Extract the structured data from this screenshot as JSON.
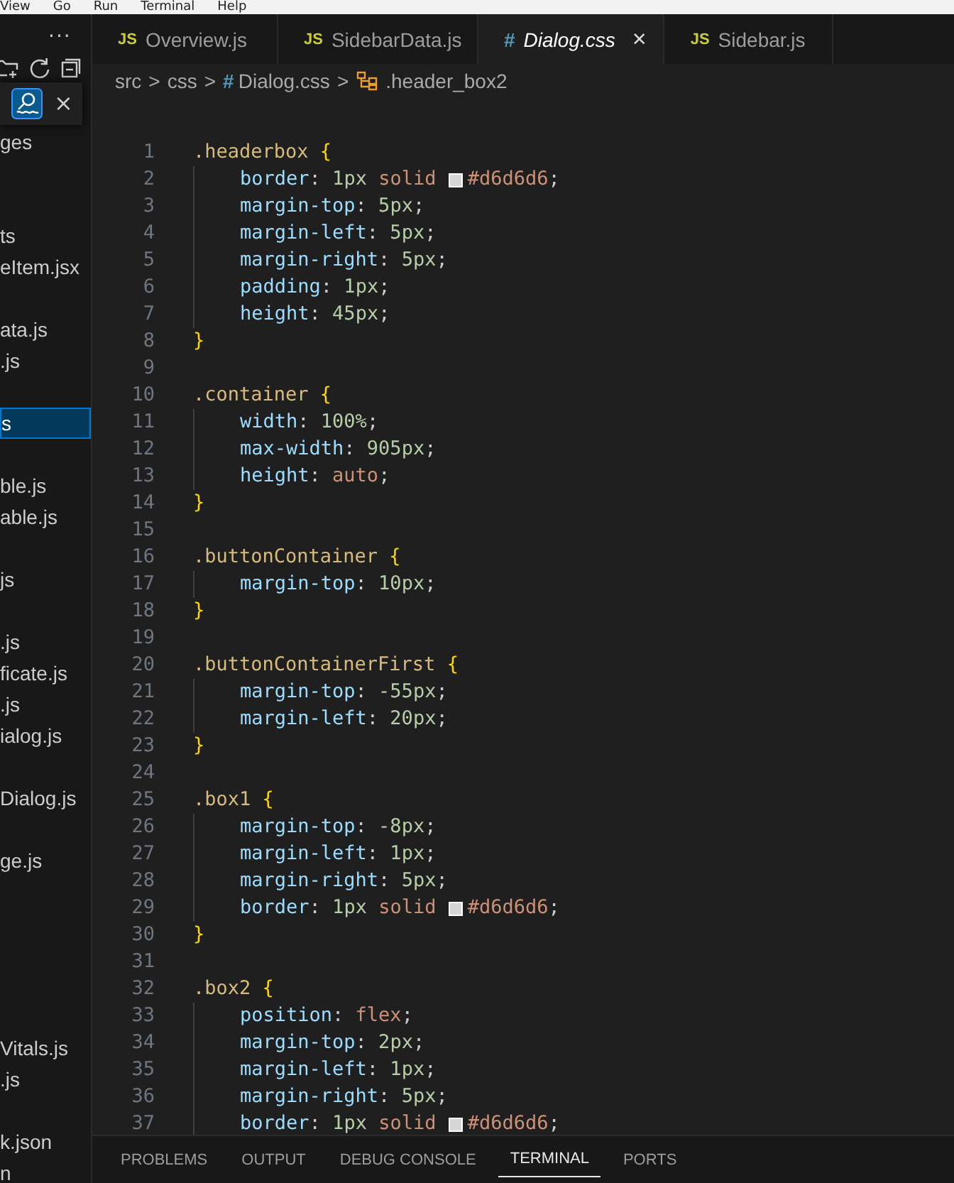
{
  "menu_bar": [
    "View",
    "Go",
    "Run",
    "Terminal",
    "Help"
  ],
  "explorer": {
    "more": "···",
    "find_close": "×",
    "items": [
      {
        "kind": "file",
        "label": "ges",
        "selected": false
      },
      {
        "kind": "blank"
      },
      {
        "kind": "blank"
      },
      {
        "kind": "file",
        "label": "ts",
        "selected": false
      },
      {
        "kind": "file",
        "label": "eItem.jsx",
        "selected": false
      },
      {
        "kind": "blank"
      },
      {
        "kind": "file",
        "label": "ata.js",
        "selected": false
      },
      {
        "kind": "file",
        "label": ".js",
        "selected": false
      },
      {
        "kind": "blank"
      },
      {
        "kind": "file",
        "label": "s",
        "selected": true
      },
      {
        "kind": "blank"
      },
      {
        "kind": "file",
        "label": "ble.js",
        "selected": false
      },
      {
        "kind": "file",
        "label": "able.js",
        "selected": false
      },
      {
        "kind": "blank"
      },
      {
        "kind": "file",
        "label": "js",
        "selected": false
      },
      {
        "kind": "blank"
      },
      {
        "kind": "file",
        "label": ".js",
        "selected": false
      },
      {
        "kind": "file",
        "label": "ficate.js",
        "selected": false
      },
      {
        "kind": "file",
        "label": ".js",
        "selected": false
      },
      {
        "kind": "file",
        "label": "ialog.js",
        "selected": false
      },
      {
        "kind": "blank"
      },
      {
        "kind": "file",
        "label": "Dialog.js",
        "selected": false
      },
      {
        "kind": "blank"
      },
      {
        "kind": "file",
        "label": "ge.js",
        "selected": false
      },
      {
        "kind": "blank"
      },
      {
        "kind": "blank"
      },
      {
        "kind": "blank"
      },
      {
        "kind": "blank"
      },
      {
        "kind": "blank"
      },
      {
        "kind": "file",
        "label": "Vitals.js",
        "selected": false
      },
      {
        "kind": "file",
        "label": ".js",
        "selected": false
      },
      {
        "kind": "blank"
      },
      {
        "kind": "file",
        "label": "k.json",
        "selected": false
      },
      {
        "kind": "file",
        "label": "n",
        "selected": false
      }
    ]
  },
  "tabs": [
    {
      "kind": "js",
      "badge": "JS",
      "label": "Overview.js",
      "selected": false
    },
    {
      "kind": "js",
      "badge": "JS",
      "label": "SidebarData.js",
      "selected": false
    },
    {
      "kind": "css",
      "badge": "#",
      "label": "Dialog.css",
      "selected": true,
      "close": "×"
    },
    {
      "kind": "js",
      "badge": "JS",
      "label": "Sidebar.js",
      "selected": false
    }
  ],
  "breadcrumb": [
    {
      "kind": "text",
      "label": "src"
    },
    {
      "kind": "sep",
      "label": ">"
    },
    {
      "kind": "text",
      "label": "css"
    },
    {
      "kind": "sep",
      "label": ">"
    },
    {
      "kind": "css",
      "badge": "#",
      "label": "Dialog.css"
    },
    {
      "kind": "sep",
      "label": ">"
    },
    {
      "kind": "symbol",
      "label": ".header_box2"
    }
  ],
  "code": [
    {
      "n": "1",
      "indent": false,
      "tokens": [
        {
          "kind": "sel",
          "text": ".headerbox "
        },
        {
          "kind": "brace",
          "text": "{"
        }
      ]
    },
    {
      "n": "2",
      "indent": true,
      "tokens": [
        {
          "kind": "prop",
          "text": "border"
        },
        {
          "kind": "punct",
          "text": ": "
        },
        {
          "kind": "num",
          "text": "1"
        },
        {
          "kind": "num",
          "text": "px"
        },
        {
          "kind": "val",
          "text": " solid "
        },
        {
          "kind": "swatch",
          "color": "#d6d6d6"
        },
        {
          "kind": "val",
          "text": "#d6d6d6"
        },
        {
          "kind": "punct",
          "text": ";"
        }
      ]
    },
    {
      "n": "3",
      "indent": true,
      "tokens": [
        {
          "kind": "prop",
          "text": "margin-top"
        },
        {
          "kind": "punct",
          "text": ": "
        },
        {
          "kind": "num",
          "text": "5"
        },
        {
          "kind": "num",
          "text": "px"
        },
        {
          "kind": "punct",
          "text": ";"
        }
      ]
    },
    {
      "n": "4",
      "indent": true,
      "tokens": [
        {
          "kind": "prop",
          "text": "margin-left"
        },
        {
          "kind": "punct",
          "text": ": "
        },
        {
          "kind": "num",
          "text": "5"
        },
        {
          "kind": "num",
          "text": "px"
        },
        {
          "kind": "punct",
          "text": ";"
        }
      ]
    },
    {
      "n": "5",
      "indent": true,
      "tokens": [
        {
          "kind": "prop",
          "text": "margin-right"
        },
        {
          "kind": "punct",
          "text": ": "
        },
        {
          "kind": "num",
          "text": "5"
        },
        {
          "kind": "num",
          "text": "px"
        },
        {
          "kind": "punct",
          "text": ";"
        }
      ]
    },
    {
      "n": "6",
      "indent": true,
      "tokens": [
        {
          "kind": "prop",
          "text": "padding"
        },
        {
          "kind": "punct",
          "text": ": "
        },
        {
          "kind": "num",
          "text": "1"
        },
        {
          "kind": "num",
          "text": "px"
        },
        {
          "kind": "punct",
          "text": ";"
        }
      ]
    },
    {
      "n": "7",
      "indent": true,
      "tokens": [
        {
          "kind": "prop",
          "text": "height"
        },
        {
          "kind": "punct",
          "text": ": "
        },
        {
          "kind": "num",
          "text": "45"
        },
        {
          "kind": "num",
          "text": "px"
        },
        {
          "kind": "punct",
          "text": ";"
        }
      ]
    },
    {
      "n": "8",
      "indent": false,
      "tokens": [
        {
          "kind": "brace",
          "text": "}"
        }
      ]
    },
    {
      "n": "9"
    },
    {
      "n": "10",
      "indent": false,
      "tokens": [
        {
          "kind": "sel",
          "text": ".container "
        },
        {
          "kind": "brace",
          "text": "{"
        }
      ]
    },
    {
      "n": "11",
      "indent": true,
      "tokens": [
        {
          "kind": "prop",
          "text": "width"
        },
        {
          "kind": "punct",
          "text": ": "
        },
        {
          "kind": "num",
          "text": "100"
        },
        {
          "kind": "num",
          "text": "%"
        },
        {
          "kind": "punct",
          "text": ";"
        }
      ]
    },
    {
      "n": "12",
      "indent": true,
      "tokens": [
        {
          "kind": "prop",
          "text": "max-width"
        },
        {
          "kind": "punct",
          "text": ": "
        },
        {
          "kind": "num",
          "text": "905"
        },
        {
          "kind": "num",
          "text": "px"
        },
        {
          "kind": "punct",
          "text": ";"
        }
      ]
    },
    {
      "n": "13",
      "indent": true,
      "tokens": [
        {
          "kind": "prop",
          "text": "height"
        },
        {
          "kind": "punct",
          "text": ": "
        },
        {
          "kind": "val",
          "text": "auto"
        },
        {
          "kind": "punct",
          "text": ";"
        }
      ]
    },
    {
      "n": "14",
      "indent": false,
      "tokens": [
        {
          "kind": "brace",
          "text": "}"
        }
      ]
    },
    {
      "n": "15"
    },
    {
      "n": "16",
      "indent": false,
      "tokens": [
        {
          "kind": "sel",
          "text": ".buttonContainer "
        },
        {
          "kind": "brace",
          "text": "{"
        }
      ]
    },
    {
      "n": "17",
      "indent": true,
      "tokens": [
        {
          "kind": "prop",
          "text": "margin-top"
        },
        {
          "kind": "punct",
          "text": ": "
        },
        {
          "kind": "num",
          "text": "10"
        },
        {
          "kind": "num",
          "text": "px"
        },
        {
          "kind": "punct",
          "text": ";"
        }
      ]
    },
    {
      "n": "18",
      "indent": false,
      "tokens": [
        {
          "kind": "brace",
          "text": "}"
        }
      ]
    },
    {
      "n": "19"
    },
    {
      "n": "20",
      "indent": false,
      "tokens": [
        {
          "kind": "sel",
          "text": ".buttonContainerFirst "
        },
        {
          "kind": "brace",
          "text": "{"
        }
      ]
    },
    {
      "n": "21",
      "indent": true,
      "tokens": [
        {
          "kind": "prop",
          "text": "margin-top"
        },
        {
          "kind": "punct",
          "text": ": "
        },
        {
          "kind": "num",
          "text": "-55"
        },
        {
          "kind": "num",
          "text": "px"
        },
        {
          "kind": "punct",
          "text": ";"
        }
      ]
    },
    {
      "n": "22",
      "indent": true,
      "tokens": [
        {
          "kind": "prop",
          "text": "margin-left"
        },
        {
          "kind": "punct",
          "text": ": "
        },
        {
          "kind": "num",
          "text": "20"
        },
        {
          "kind": "num",
          "text": "px"
        },
        {
          "kind": "punct",
          "text": ";"
        }
      ]
    },
    {
      "n": "23",
      "indent": false,
      "tokens": [
        {
          "kind": "brace",
          "text": "}"
        }
      ]
    },
    {
      "n": "24"
    },
    {
      "n": "25",
      "indent": false,
      "tokens": [
        {
          "kind": "sel",
          "text": ".box1 "
        },
        {
          "kind": "brace",
          "text": "{"
        }
      ]
    },
    {
      "n": "26",
      "indent": true,
      "tokens": [
        {
          "kind": "prop",
          "text": "margin-top"
        },
        {
          "kind": "punct",
          "text": ": "
        },
        {
          "kind": "num",
          "text": "-8"
        },
        {
          "kind": "num",
          "text": "px"
        },
        {
          "kind": "punct",
          "text": ";"
        }
      ]
    },
    {
      "n": "27",
      "indent": true,
      "tokens": [
        {
          "kind": "prop",
          "text": "margin-left"
        },
        {
          "kind": "punct",
          "text": ": "
        },
        {
          "kind": "num",
          "text": "1"
        },
        {
          "kind": "num",
          "text": "px"
        },
        {
          "kind": "punct",
          "text": ";"
        }
      ]
    },
    {
      "n": "28",
      "indent": true,
      "tokens": [
        {
          "kind": "prop",
          "text": "margin-right"
        },
        {
          "kind": "punct",
          "text": ": "
        },
        {
          "kind": "num",
          "text": "5"
        },
        {
          "kind": "num",
          "text": "px"
        },
        {
          "kind": "punct",
          "text": ";"
        }
      ]
    },
    {
      "n": "29",
      "indent": true,
      "tokens": [
        {
          "kind": "prop",
          "text": "border"
        },
        {
          "kind": "punct",
          "text": ": "
        },
        {
          "kind": "num",
          "text": "1"
        },
        {
          "kind": "num",
          "text": "px"
        },
        {
          "kind": "val",
          "text": " solid "
        },
        {
          "kind": "swatch",
          "color": "#d6d6d6"
        },
        {
          "kind": "val",
          "text": "#d6d6d6"
        },
        {
          "kind": "punct",
          "text": ";"
        }
      ]
    },
    {
      "n": "30",
      "indent": false,
      "tokens": [
        {
          "kind": "brace",
          "text": "}"
        }
      ]
    },
    {
      "n": "31"
    },
    {
      "n": "32",
      "indent": false,
      "tokens": [
        {
          "kind": "sel",
          "text": ".box2 "
        },
        {
          "kind": "brace",
          "text": "{"
        }
      ]
    },
    {
      "n": "33",
      "indent": true,
      "tokens": [
        {
          "kind": "prop",
          "text": "position"
        },
        {
          "kind": "punct",
          "text": ": "
        },
        {
          "kind": "val",
          "text": "flex"
        },
        {
          "kind": "punct",
          "text": ";"
        }
      ]
    },
    {
      "n": "34",
      "indent": true,
      "tokens": [
        {
          "kind": "prop",
          "text": "margin-top"
        },
        {
          "kind": "punct",
          "text": ": "
        },
        {
          "kind": "num",
          "text": "2"
        },
        {
          "kind": "num",
          "text": "px"
        },
        {
          "kind": "punct",
          "text": ";"
        }
      ]
    },
    {
      "n": "35",
      "indent": true,
      "tokens": [
        {
          "kind": "prop",
          "text": "margin-left"
        },
        {
          "kind": "punct",
          "text": ": "
        },
        {
          "kind": "num",
          "text": "1"
        },
        {
          "kind": "num",
          "text": "px"
        },
        {
          "kind": "punct",
          "text": ";"
        }
      ]
    },
    {
      "n": "36",
      "indent": true,
      "tokens": [
        {
          "kind": "prop",
          "text": "margin-right"
        },
        {
          "kind": "punct",
          "text": ": "
        },
        {
          "kind": "num",
          "text": "5"
        },
        {
          "kind": "num",
          "text": "px"
        },
        {
          "kind": "punct",
          "text": ";"
        }
      ]
    },
    {
      "n": "37",
      "indent": true,
      "tokens": [
        {
          "kind": "prop",
          "text": "border"
        },
        {
          "kind": "punct",
          "text": ": "
        },
        {
          "kind": "num",
          "text": "1"
        },
        {
          "kind": "num",
          "text": "px"
        },
        {
          "kind": "val",
          "text": " solid "
        },
        {
          "kind": "swatch",
          "color": "#d6d6d6"
        },
        {
          "kind": "val",
          "text": "#d6d6d6"
        },
        {
          "kind": "punct",
          "text": ";"
        }
      ]
    }
  ],
  "panel_tabs": [
    {
      "label": "PROBLEMS",
      "selected": false
    },
    {
      "label": "OUTPUT",
      "selected": false
    },
    {
      "label": "DEBUG CONSOLE",
      "selected": false
    },
    {
      "label": "TERMINAL",
      "selected": true
    },
    {
      "label": "PORTS",
      "selected": false
    }
  ]
}
